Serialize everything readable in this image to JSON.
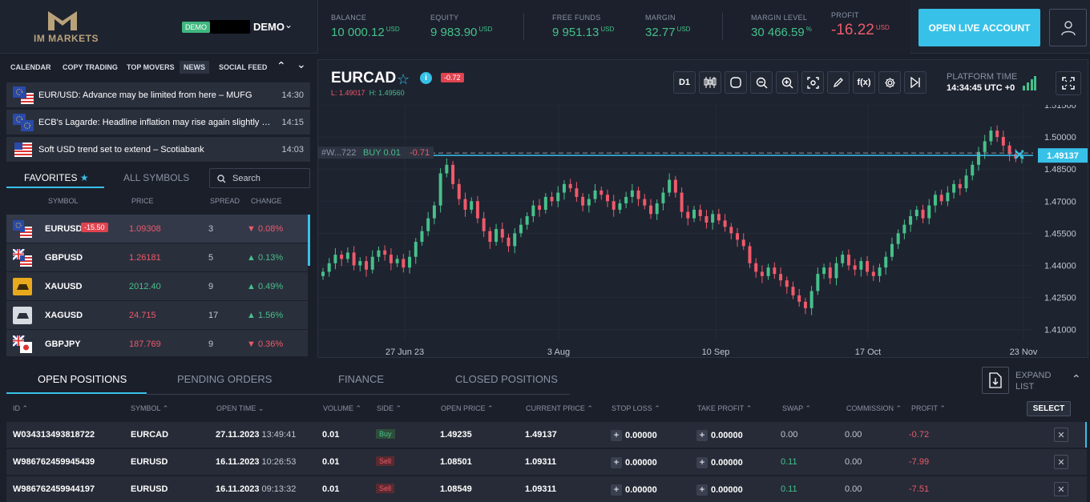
{
  "header": {
    "logo_text": "IM MARKETS",
    "demo_badge": "DEMO",
    "account_name": "DEMO",
    "stats": [
      {
        "label": "BALANCE",
        "value": "10 000.12",
        "unit": "USD"
      },
      {
        "label": "EQUITY",
        "value": "9 983.90",
        "unit": "USD"
      },
      {
        "label": "FREE FUNDS",
        "value": "9 951.13",
        "unit": "USD"
      },
      {
        "label": "MARGIN",
        "value": "32.77",
        "unit": "USD"
      },
      {
        "label": "MARGIN LEVEL",
        "value": "30 466.59",
        "unit": "%"
      },
      {
        "label": "PROFIT",
        "value": "-16.22",
        "unit": "USD"
      }
    ],
    "open_live": "OPEN LIVE ACCOUNT",
    "icons": {
      "user": "user-icon",
      "caret": "chevron-down-icon"
    }
  },
  "news_tabs": [
    "CALENDAR",
    "COPY TRADING",
    "TOP MOVERS",
    "NEWS",
    "SOCIAL FEED"
  ],
  "news": [
    {
      "title": "EUR/USD: Advance may be limited from here – MUFG",
      "time": "14:30",
      "flag": "eu-us"
    },
    {
      "title": "ECB's Lagarde: Headline inflation may rise again slightly in ...",
      "time": "14:15",
      "flag": "eu"
    },
    {
      "title": "Soft USD trend set to extend – Scotiabank",
      "time": "14:03",
      "flag": "us"
    }
  ],
  "symbols_panel": {
    "favorites_tab": "FAVORITES",
    "all_tab": "ALL SYMBOLS",
    "search_placeholder": "Search",
    "columns": [
      "SYMBOL",
      "PRICE",
      "SPREAD",
      "CHANGE"
    ],
    "rows": [
      {
        "symbol": "EURUSD",
        "badge": "-15.50",
        "price": "1.09308",
        "spread": "3",
        "change": "0.08%",
        "dir": "down"
      },
      {
        "symbol": "GBPUSD",
        "badge": "",
        "price": "1.26181",
        "spread": "5",
        "change": "0.13%",
        "dir": "up"
      },
      {
        "symbol": "XAUUSD",
        "badge": "",
        "price": "2012.40",
        "spread": "9",
        "change": "0.49%",
        "dir": "up"
      },
      {
        "symbol": "XAGUSD",
        "badge": "",
        "price": "24.715",
        "spread": "17",
        "change": "1.56%",
        "dir": "up"
      },
      {
        "symbol": "GBPJPY",
        "badge": "",
        "price": "187.769",
        "spread": "9",
        "change": "0.36%",
        "dir": "down"
      }
    ]
  },
  "chart": {
    "symbol": "EURCAD",
    "change_badge": "-0.72",
    "low_label": "L: 1.49017",
    "high_label": "H: 1.49560",
    "timeframe": "D1",
    "platform_time_label": "PLATFORM TIME",
    "platform_time": "14:34:45 UTC +0",
    "position_label_id": "#W...722",
    "position_label_side": "BUY 0.01",
    "position_label_pl": "-0.71",
    "current_price_tag": "1.49137"
  },
  "chart_data": {
    "type": "candlestick",
    "y_ticks": [
      "1.51500",
      "1.50000",
      "1.48500",
      "1.47000",
      "1.45500",
      "1.44000",
      "1.42500",
      "1.41000"
    ],
    "ylim": [
      1.405,
      1.515
    ],
    "x_ticks": [
      "27 Jun 23",
      "3 Aug",
      "10 Sep",
      "17 Oct",
      "23 Nov"
    ],
    "close_path": [
      1.437,
      1.441,
      1.445,
      1.443,
      1.446,
      1.44,
      1.442,
      1.438,
      1.444,
      1.447,
      1.445,
      1.441,
      1.443,
      1.439,
      1.444,
      1.451,
      1.456,
      1.462,
      1.468,
      1.483,
      1.487,
      1.478,
      1.471,
      1.466,
      1.47,
      1.462,
      1.456,
      1.451,
      1.457,
      1.453,
      1.449,
      1.455,
      1.459,
      1.463,
      1.468,
      1.466,
      1.472,
      1.47,
      1.474,
      1.478,
      1.476,
      1.472,
      1.468,
      1.471,
      1.475,
      1.473,
      1.47,
      1.466,
      1.469,
      1.472,
      1.475,
      1.471,
      1.468,
      1.464,
      1.469,
      1.474,
      1.48,
      1.474,
      1.465,
      1.462,
      1.466,
      1.463,
      1.46,
      1.464,
      1.461,
      1.458,
      1.455,
      1.452,
      1.449,
      1.441,
      1.437,
      1.435,
      1.439,
      1.436,
      1.433,
      1.43,
      1.426,
      1.423,
      1.42,
      1.428,
      1.436,
      1.439,
      1.434,
      1.441,
      1.445,
      1.44,
      1.438,
      1.442,
      1.437,
      1.435,
      1.439,
      1.444,
      1.45,
      1.455,
      1.459,
      1.463,
      1.466,
      1.462,
      1.468,
      1.473,
      1.47,
      1.474,
      1.478,
      1.476,
      1.482,
      1.487,
      1.493,
      1.498,
      1.503,
      1.5,
      1.496,
      1.492,
      1.49,
      1.491
    ],
    "current_price": 1.49137
  },
  "bottom": {
    "tabs": [
      "OPEN POSITIONS",
      "PENDING ORDERS",
      "FINANCE",
      "CLOSED POSITIONS"
    ],
    "expand_label": "EXPAND LIST",
    "select_label": "SELECT",
    "columns": [
      "ID",
      "SYMBOL",
      "OPEN TIME",
      "VOLUME",
      "SIDE",
      "OPEN PRICE",
      "CURRENT PRICE",
      "STOP LOSS",
      "TAKE PROFIT",
      "SWAP",
      "COMMISSION",
      "PROFIT"
    ],
    "rows": [
      {
        "id": "W034313493818722",
        "symbol": "EURCAD",
        "date": "27.11.2023",
        "time": "13:49:41",
        "volume": "0.01",
        "side": "Buy",
        "open": "1.49235",
        "current": "1.49137",
        "sl": "0.00000",
        "tp": "0.00000",
        "swap": "0.00",
        "commission": "0.00",
        "profit": "-0.72"
      },
      {
        "id": "W986762459945439",
        "symbol": "EURUSD",
        "date": "16.11.2023",
        "time": "10:26:53",
        "volume": "0.01",
        "side": "Sell",
        "open": "1.08501",
        "current": "1.09311",
        "sl": "0.00000",
        "tp": "0.00000",
        "swap": "0.11",
        "commission": "0.00",
        "profit": "-7.99"
      },
      {
        "id": "W986762459944197",
        "symbol": "EURUSD",
        "date": "16.11.2023",
        "time": "09:13:32",
        "volume": "0.01",
        "side": "Sell",
        "open": "1.08549",
        "current": "1.09311",
        "sl": "0.00000",
        "tp": "0.00000",
        "swap": "0.11",
        "commission": "0.00",
        "profit": "-7.51"
      }
    ]
  }
}
